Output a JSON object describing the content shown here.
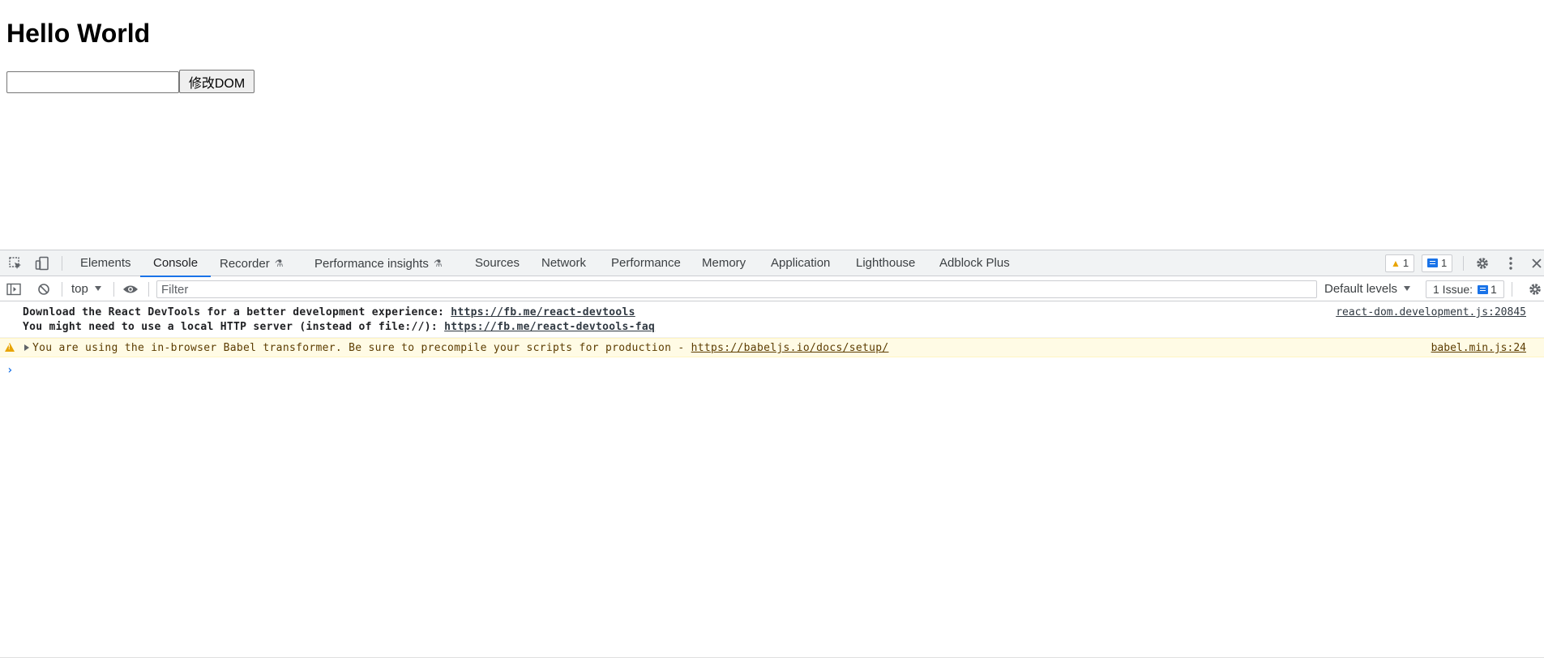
{
  "page": {
    "heading": "Hello World",
    "input_value": "",
    "button_label": "修改DOM"
  },
  "devtools": {
    "tabs": [
      {
        "label": "Elements"
      },
      {
        "label": "Console"
      },
      {
        "label": "Recorder"
      },
      {
        "label": "Performance insights"
      },
      {
        "label": "Sources"
      },
      {
        "label": "Network"
      },
      {
        "label": "Performance"
      },
      {
        "label": "Memory"
      },
      {
        "label": "Application"
      },
      {
        "label": "Lighthouse"
      },
      {
        "label": "Adblock Plus"
      }
    ],
    "active_tab": "Console",
    "warning_count": "1",
    "message_count": "1",
    "toolbar": {
      "context": "top",
      "filter_placeholder": "Filter",
      "filter_value": "",
      "levels": "Default levels",
      "issues_label": "1 Issue:",
      "issues_count": "1"
    },
    "messages": [
      {
        "type": "log",
        "line1_text": "Download the React DevTools for a better development experience: ",
        "line1_link": "https://fb.me/react-devtools",
        "line2_text": "You might need to use a local HTTP server (instead of file://): ",
        "line2_link": "https://fb.me/react-devtools-faq",
        "source": "react-dom.development.js:20845"
      },
      {
        "type": "warning",
        "text": "You are using the in-browser Babel transformer. Be sure to precompile your scripts for production - ",
        "link": "https://babeljs.io/docs/setup/",
        "source": "babel.min.js:24"
      }
    ],
    "prompt_symbol": "›"
  },
  "colors": {
    "accent": "#1a73e8",
    "warning": "#e8a400",
    "warning_bg": "#fffbe5",
    "toolbar_bg": "#f1f3f4"
  },
  "icons": {
    "inspect": "inspect-element-icon",
    "device": "device-toolbar-icon",
    "flask": "experiment-flask-icon",
    "settings": "gear-icon",
    "more": "kebab-menu-icon",
    "close": "close-icon",
    "sidebar": "sidebar-toggle-icon",
    "clear": "clear-console-icon",
    "eye": "live-expression-eye-icon",
    "warning": "warning-triangle-icon"
  }
}
